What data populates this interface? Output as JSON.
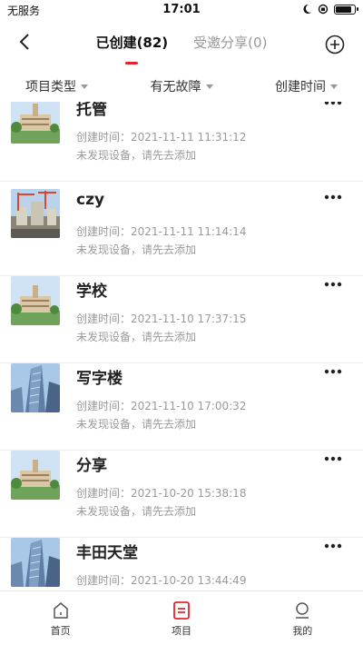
{
  "status": {
    "carrier": "无服务",
    "time": "17:01",
    "battery_level": 0.9
  },
  "header": {
    "tabs": [
      {
        "label": "已创建(82)",
        "active": true
      },
      {
        "label": "受邀分享(0)",
        "active": false
      }
    ],
    "accent_color": "#e0252d"
  },
  "filters": [
    {
      "label": "项目类型"
    },
    {
      "label": "有无故障"
    },
    {
      "label": "创建时间"
    }
  ],
  "projects": [
    {
      "name": "托管",
      "created": "创建时间：2021-11-11 11:31:12",
      "desc": "未发现设备，请先去添加",
      "thumb": "campus-building"
    },
    {
      "name": "czy",
      "created": "创建时间：2021-11-11 11:14:14",
      "desc": "未发现设备，请先去添加",
      "thumb": "construction-site"
    },
    {
      "name": "学校",
      "created": "创建时间：2021-11-10 17:37:15",
      "desc": "未发现设备，请先去添加",
      "thumb": "campus-building"
    },
    {
      "name": "写字楼",
      "created": "创建时间：2021-11-10 17:00:32",
      "desc": "未发现设备，请先去添加",
      "thumb": "office-tower"
    },
    {
      "name": "分享",
      "created": "创建时间：2021-10-20 15:38:18",
      "desc": "未发现设备，请先去添加",
      "thumb": "campus-building"
    },
    {
      "name": "丰田天堂",
      "created": "创建时间：2021-10-20 13:44:49",
      "desc": "",
      "thumb": "office-tower"
    }
  ],
  "tabbar": [
    {
      "label": "首页",
      "icon": "home-icon"
    },
    {
      "label": "项目",
      "icon": "project-icon",
      "active": true
    },
    {
      "label": "我的",
      "icon": "profile-icon"
    }
  ]
}
